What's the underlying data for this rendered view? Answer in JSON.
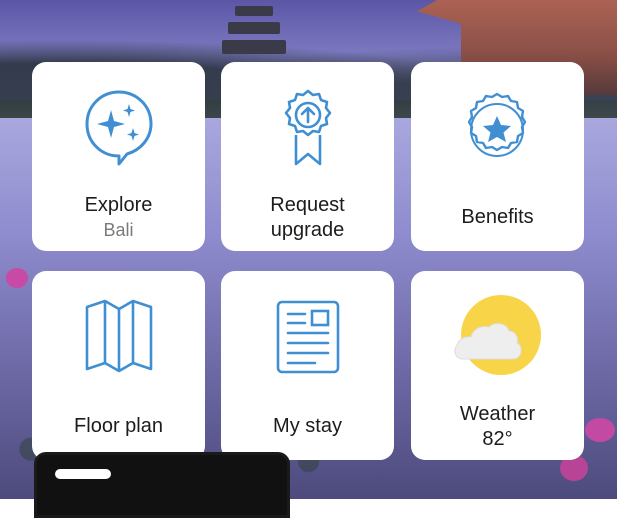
{
  "tiles": [
    {
      "label": "Explore",
      "sub": "Bali",
      "icon": "sparkle-chat-icon"
    },
    {
      "label1": "Request",
      "label2": "upgrade",
      "icon": "award-ribbon-icon"
    },
    {
      "label": "Benefits",
      "icon": "star-badge-icon"
    },
    {
      "label": "Floor plan",
      "icon": "map-icon"
    },
    {
      "label": "My stay",
      "icon": "document-icon"
    },
    {
      "label1": "Weather",
      "label2": "82°",
      "icon": "partly-sunny-icon"
    }
  ],
  "colors": {
    "icon_blue": "#3f8fd2",
    "sun_yellow": "#f7d448",
    "cloud_gray": "#eeeeee"
  }
}
